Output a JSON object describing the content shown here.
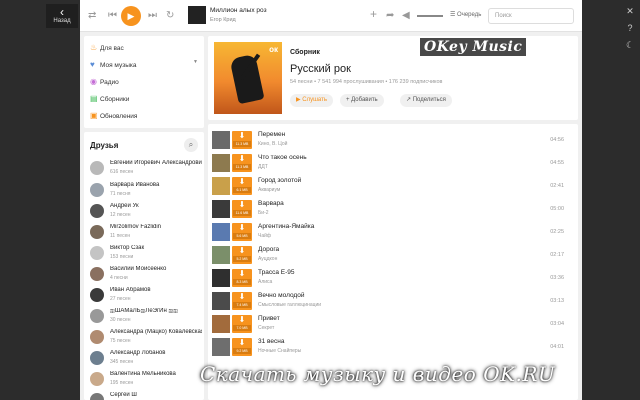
{
  "back": {
    "label": "Назад"
  },
  "player": {
    "title": "Миллион алых роз",
    "artist": "Егор Крид",
    "queue_label": "Очередь",
    "search_placeholder": "Поиск"
  },
  "nav": {
    "items": [
      {
        "label": "Для вас",
        "icon": "fire-icon",
        "color": "#f7931e"
      },
      {
        "label": "Моя музыка",
        "icon": "heart-icon",
        "color": "#5b8dd6"
      },
      {
        "label": "Радио",
        "icon": "radio-icon",
        "color": "#c56fd6"
      },
      {
        "label": "Сборники",
        "icon": "collection-icon",
        "color": "#3cba54"
      },
      {
        "label": "Обновления",
        "icon": "updates-icon",
        "color": "#f7931e"
      }
    ]
  },
  "friends": {
    "title": "Друзья",
    "list": [
      {
        "name": "Евгений Игоревич Александрович",
        "count": "616 песен"
      },
      {
        "name": "Варвара Иванова",
        "count": "71 песня"
      },
      {
        "name": "Андрей Ук",
        "count": "12 песен"
      },
      {
        "name": "Mirzolimov Fazlidin",
        "count": "11 песен"
      },
      {
        "name": "Виктор Сзак",
        "count": "153 песни"
      },
      {
        "name": "Василий Моисеенко",
        "count": "4 песни"
      },
      {
        "name": "Иван Абрамов",
        "count": "27 песен"
      },
      {
        "name": "ஐШАМаЛЬஐЛеЭгИн ஐஐ",
        "count": "30 песен"
      },
      {
        "name": "Александра (Мацко) Ковалевская",
        "count": "75 песен"
      },
      {
        "name": "Александр Лобанов",
        "count": "345 песен"
      },
      {
        "name": "Валентина Мельникова",
        "count": "195 песен"
      },
      {
        "name": "Сергей Ш",
        "count": ""
      }
    ]
  },
  "collection": {
    "type_label": "Сборник",
    "name": "Русский рок",
    "stats": "54 песни • 7 541 994 прослушивания • 176 239 подписчиков",
    "listen_label": "▶ Слушать",
    "add_label": "+ Добавить",
    "share_label": "↗ Поделиться"
  },
  "tracks": [
    {
      "title": "Перемен",
      "artist": "Кино, В. Цой",
      "duration": "04:56",
      "size": "11.3 MB",
      "color": "#6a6a6a"
    },
    {
      "title": "Что такое осень",
      "artist": "ДДТ",
      "duration": "04:55",
      "size": "11.3 MB",
      "color": "#8d7a4f"
    },
    {
      "title": "Город золотой",
      "artist": "Аквариум",
      "duration": "02:41",
      "size": "6.1 MB",
      "color": "#c9a04a"
    },
    {
      "title": "Варвара",
      "artist": "Би-2",
      "duration": "05:00",
      "size": "11.6 MB",
      "color": "#3a3a3a"
    },
    {
      "title": "Аргентина-Ямайка",
      "artist": "Чайф",
      "duration": "02:25",
      "size": "5.6 MB",
      "color": "#5a7ab0"
    },
    {
      "title": "Дорога",
      "artist": "Ауцдкон",
      "duration": "02:17",
      "size": "5.2 MB",
      "color": "#7b8f6a"
    },
    {
      "title": "Трасса Е-95",
      "artist": "Алиса",
      "duration": "03:36",
      "size": "8.3 MB",
      "color": "#2f2f2f"
    },
    {
      "title": "Вечно молодой",
      "artist": "Смысловые галлюцинации",
      "duration": "03:13",
      "size": "7.4 MB",
      "color": "#4b4b4b"
    },
    {
      "title": "Привет",
      "artist": "Секрет",
      "duration": "03:04",
      "size": "7.0 MB",
      "color": "#a26b3c"
    },
    {
      "title": "31 весна",
      "artist": "Ночные Снайперы",
      "duration": "04:01",
      "size": "9.2 MB",
      "color": "#6e6e6e"
    }
  ],
  "watermark": "OKey Music",
  "banner": "Скачать музыку и видео OK.RU",
  "accent_color": "#f7931e"
}
